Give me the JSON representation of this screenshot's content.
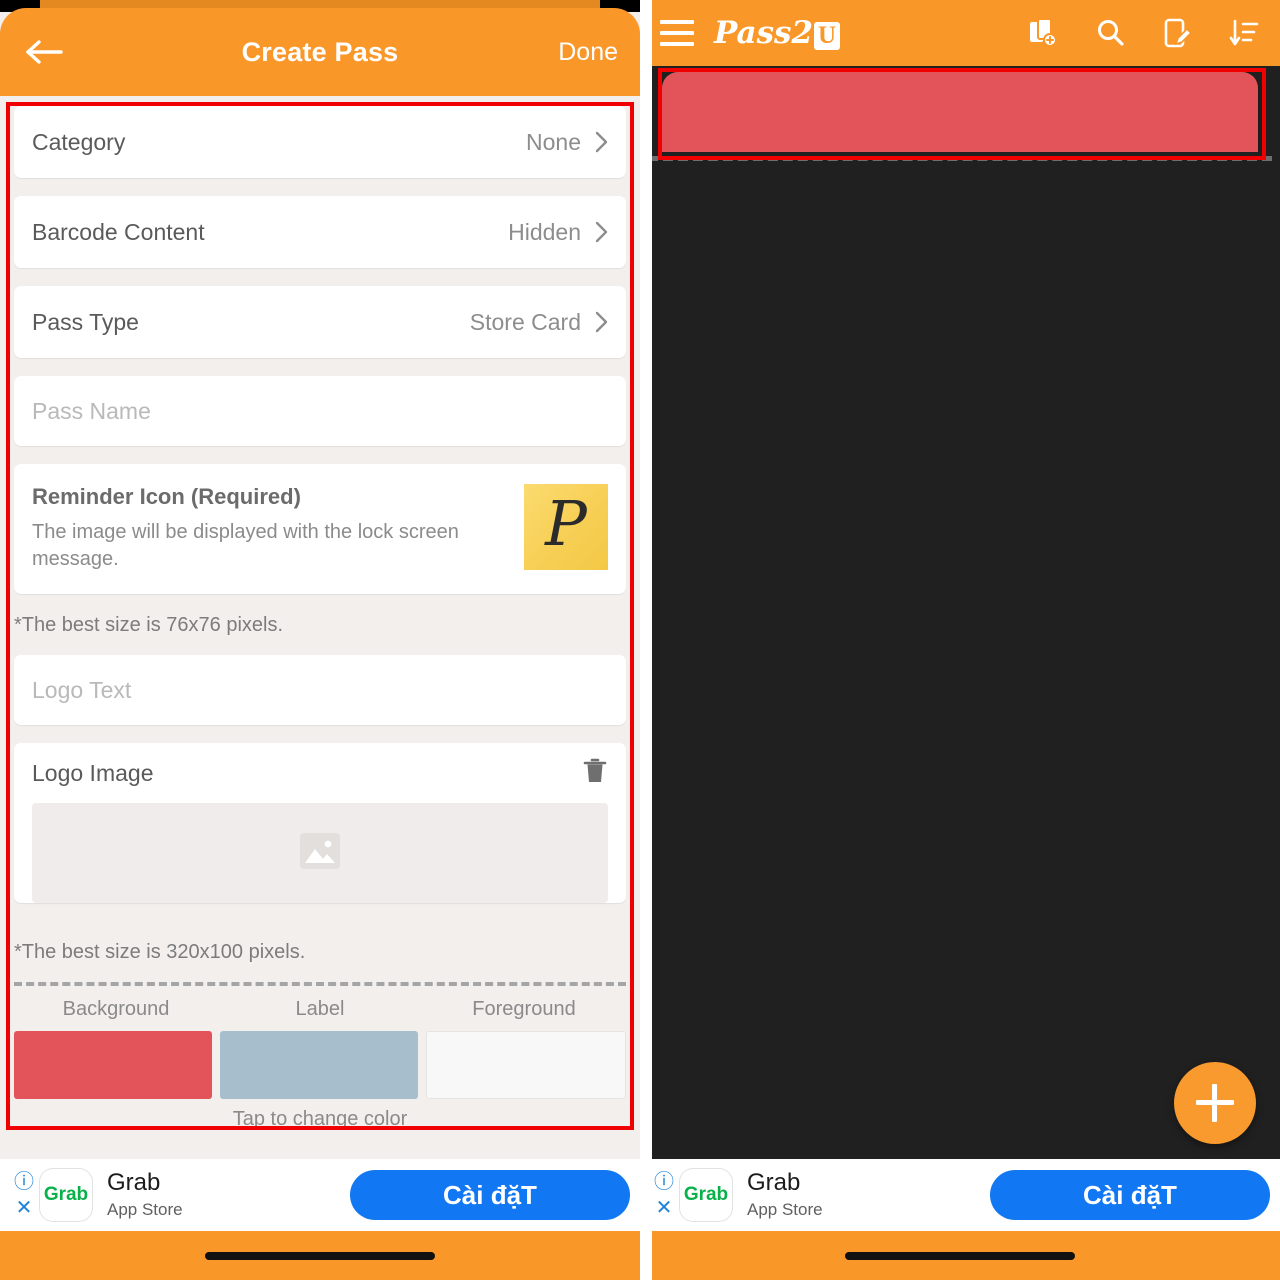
{
  "left_screen": {
    "header": {
      "back_icon": "back-arrow-icon",
      "title": "Create Pass",
      "done_label": "Done"
    },
    "form_rows": [
      {
        "label": "Category",
        "value": "None",
        "chevron": "chevron-right-icon"
      },
      {
        "label": "Barcode Content",
        "value": "Hidden",
        "chevron": "chevron-right-icon"
      },
      {
        "label": "Pass Type",
        "value": "Store Card",
        "chevron": "chevron-right-icon"
      }
    ],
    "pass_name_input": {
      "placeholder": "Pass Name",
      "value": ""
    },
    "reminder_icon_section": {
      "title": "Reminder Icon (Required)",
      "description": "The image will be displayed with the lock screen message.",
      "thumbnail_glyph": "P",
      "thumbnail_color": "#f5cf51",
      "note": "*The best size is 76x76 pixels."
    },
    "logo_text_input": {
      "placeholder": "Logo Text",
      "value": ""
    },
    "logo_image_section": {
      "title": "Logo Image",
      "delete_icon": "trash-icon",
      "placeholder_icon": "image-placeholder-icon",
      "note": "*The best size is 320x100 pixels."
    },
    "colors_section": {
      "labels": [
        "Background",
        "Label",
        "Foreground"
      ],
      "values": [
        "#e3545a",
        "#a7bfcd",
        "#f8f8f8"
      ],
      "hint": "Tap to change color"
    }
  },
  "right_screen": {
    "header": {
      "menu_icon": "hamburger-menu-icon",
      "brand": "Pass2",
      "brand_suffix": "U",
      "actions": [
        "add-pass-icon",
        "search-icon",
        "edit-pass-icon",
        "sort-icon"
      ]
    },
    "pass_card": {
      "color": "#e3545a"
    },
    "fab": {
      "icon": "plus-icon",
      "color": "#f89a2e"
    }
  },
  "ad_banner": {
    "info_icon": "info-icon",
    "close_icon": "close-icon",
    "app_icon_text": "Grab",
    "title": "Grab",
    "subtitle": "App Store",
    "cta_label": "Cài đặT",
    "cta_color": "#1277f2"
  },
  "theme": {
    "accent_orange": "#fa9729",
    "dark_body": "#202020",
    "page_background": "#f2efed",
    "annotation_red": "#f00000"
  }
}
